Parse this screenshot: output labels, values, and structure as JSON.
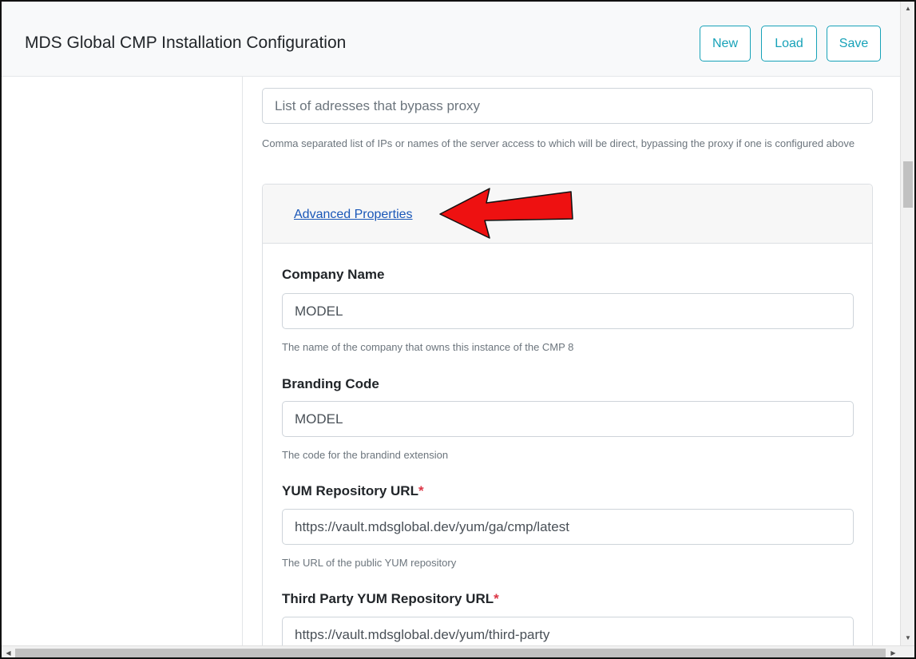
{
  "header": {
    "title": "MDS Global CMP Installation Configuration",
    "buttons": {
      "new": "New",
      "load": "Load",
      "save": "Save"
    }
  },
  "bypass_proxy": {
    "placeholder": "List of adresses that bypass proxy",
    "help": "Comma separated list of IPs or names of the server access to which will be direct, bypassing the proxy if one is configured above"
  },
  "advanced": {
    "link": "Advanced Properties",
    "fields": [
      {
        "label": "Company Name",
        "required": false,
        "value": "MODEL",
        "help": "The name of the company that owns this instance of the CMP 8"
      },
      {
        "label": "Branding Code",
        "required": false,
        "value": "MODEL",
        "help": "The code for the brandind extension"
      },
      {
        "label": "YUM Repository URL",
        "required": true,
        "value": "https://vault.mdsglobal.dev/yum/ga/cmp/latest",
        "help": "The URL of the public YUM repository"
      },
      {
        "label": "Third Party YUM Repository URL",
        "required": true,
        "value": "https://vault.mdsglobal.dev/yum/third-party",
        "help": ""
      }
    ],
    "required_mark": "*"
  },
  "colors": {
    "accent": "#17a2b8",
    "link": "#1a57b8",
    "required": "#dc3545",
    "arrow": "#ee1111"
  },
  "icons": {
    "arrow": "red-arrow-annotation"
  }
}
